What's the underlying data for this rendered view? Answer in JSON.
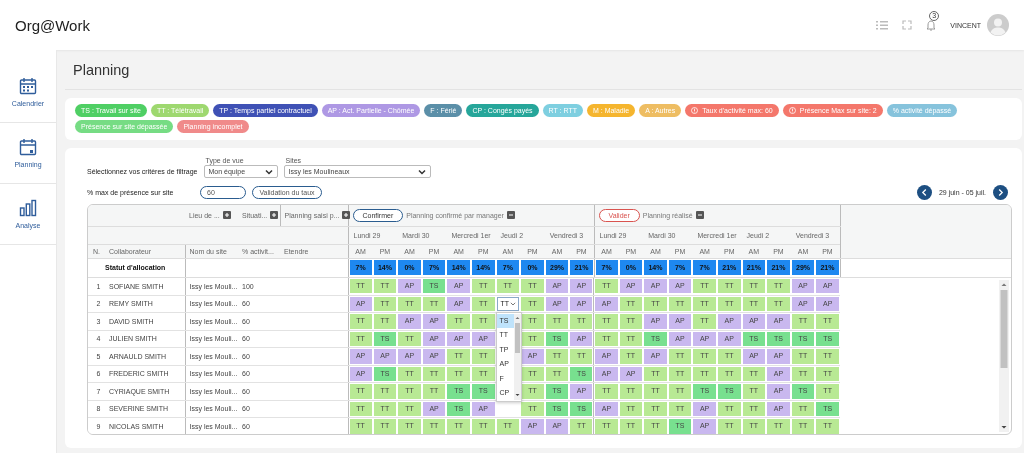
{
  "app": {
    "logo": "Org@Work",
    "notifications": "3",
    "user": "VINCENT"
  },
  "sidebar": {
    "items": [
      {
        "label": "Calendrier",
        "kind": "calendar"
      },
      {
        "label": "Planning",
        "kind": "planning"
      },
      {
        "label": "Analyse",
        "kind": "chart"
      }
    ]
  },
  "page": {
    "title": "Planning"
  },
  "legend": [
    {
      "label": "TS : Travail sur site",
      "color": "#4fcf64",
      "kind": "plain"
    },
    {
      "label": "TT : Télétravail",
      "color": "#9ed86f",
      "kind": "plain"
    },
    {
      "label": "TP : Temps partiel contractuel",
      "color": "#3f51b5",
      "kind": "plain"
    },
    {
      "label": "AP : Act. Partielle - Chômée",
      "color": "#ae98e4",
      "kind": "plain"
    },
    {
      "label": "F : Férié",
      "color": "#5b8fa8",
      "kind": "plain"
    },
    {
      "label": "CP : Congés payés",
      "color": "#26a69a",
      "kind": "plain"
    },
    {
      "label": "RT : RTT",
      "color": "#7ecfe0",
      "kind": "plain"
    },
    {
      "label": "M : Maladie",
      "color": "#f5b52e",
      "kind": "plain"
    },
    {
      "label": "A : Autres",
      "color": "#eebd62",
      "kind": "plain"
    },
    {
      "label": "Taux d'activité max: 60",
      "color": "#f4776b",
      "kind": "warning"
    },
    {
      "label": "Présence Max sur site: 2",
      "color": "#f4776b",
      "kind": "warning"
    },
    {
      "label": "% activité dépassé",
      "color": "#86c3dc",
      "kind": "plain"
    },
    {
      "label": "Présence sur site dépassée",
      "color": "#76dc84",
      "kind": "plain"
    },
    {
      "label": "Planning incomplet",
      "color": "#f08a8a",
      "kind": "plain"
    }
  ],
  "filters": {
    "title": "Sélectionnez vos critères de filtrage",
    "view_type": {
      "label": "Type de vue",
      "value": "Mon équipe"
    },
    "sites": {
      "label": "Sites",
      "value": "Issy les Moulineaux"
    },
    "max_presence": {
      "label": "% max de présence sur site",
      "value": "60",
      "button": "Validation du taux"
    },
    "period": "29 juin - 05 juil."
  },
  "table": {
    "group_headers": [
      {
        "label": "Lieu de ...",
        "expanded": false
      },
      {
        "label": "Situati...",
        "expanded": false
      },
      {
        "label": "Planning saisi p...",
        "expanded": false
      }
    ],
    "sections": [
      {
        "button": "Confirmer",
        "kind": "confirm",
        "title": "Planning confirmé par manager",
        "expanded": true,
        "days": [
          "Lundi 29",
          "Mardi 30",
          "Mercredi 1er",
          "Jeudi 2",
          "Vendredi 3"
        ],
        "slots": [
          "AM",
          "PM",
          "AM",
          "PM",
          "AM",
          "PM",
          "AM",
          "PM",
          "AM",
          "PM"
        ]
      },
      {
        "button": "Valider",
        "kind": "validate",
        "title": "Planning réalisé",
        "expanded": true,
        "days": [
          "Lundi 29",
          "Mardi 30",
          "Mercredi 1er",
          "Jeudi 2",
          "Vendredi 3"
        ],
        "slots": [
          "AM",
          "PM",
          "AM",
          "PM",
          "AM",
          "PM",
          "AM",
          "PM",
          "AM",
          "PM"
        ]
      }
    ],
    "columns": [
      "N.",
      "Collaborateur",
      "Nom du site",
      "% activit...",
      "Etendre"
    ],
    "allocation": {
      "label": "Statut d'allocation",
      "values": [
        "7%",
        "14%",
        "0%",
        "7%",
        "14%",
        "14%",
        "7%",
        "0%",
        "29%",
        "21%",
        "7%",
        "0%",
        "14%",
        "7%",
        "7%",
        "21%",
        "21%",
        "21%",
        "29%",
        "21%"
      ]
    },
    "rows": [
      {
        "n": "1",
        "name": "SOFIANE SMITH",
        "site": "Issy les Mouli...",
        "activity": "100",
        "cells": [
          {
            "code": "TT",
            "kind": "tt"
          },
          {
            "code": "TT",
            "kind": "tt"
          },
          {
            "code": "AP",
            "kind": "ap"
          },
          {
            "code": "TS",
            "kind": "ts"
          },
          {
            "code": "AP",
            "kind": "ap"
          },
          {
            "code": "TT",
            "kind": "tt"
          },
          {
            "code": "TT",
            "kind": "tt"
          },
          {
            "code": "TT",
            "kind": "tt"
          },
          {
            "code": "AP",
            "kind": "ap"
          },
          {
            "code": "AP",
            "kind": "ap"
          },
          {
            "code": "TT",
            "kind": "tt"
          },
          {
            "code": "AP",
            "kind": "ap"
          },
          {
            "code": "AP",
            "kind": "ap"
          },
          {
            "code": "AP",
            "kind": "ap"
          },
          {
            "code": "TT",
            "kind": "tt"
          },
          {
            "code": "TT",
            "kind": "tt"
          },
          {
            "code": "TT",
            "kind": "tt"
          },
          {
            "code": "TT",
            "kind": "tt"
          },
          {
            "code": "AP",
            "kind": "ap"
          },
          {
            "code": "AP",
            "kind": "ap"
          }
        ]
      },
      {
        "n": "2",
        "name": "REMY SMITH",
        "site": "Issy les Mouli...",
        "activity": "60",
        "cells": [
          {
            "code": "AP",
            "kind": "ap"
          },
          {
            "code": "TT",
            "kind": "tt"
          },
          {
            "code": "TT",
            "kind": "tt"
          },
          {
            "code": "TT",
            "kind": "tt"
          },
          {
            "code": "AP",
            "kind": "ap"
          },
          {
            "code": "TT",
            "kind": "tt"
          },
          {
            "code": "TT",
            "kind": "select",
            "expanded": true,
            "options": [
              {
                "label": "TS",
                "selected": true
              },
              {
                "label": "TT",
                "selected": false
              },
              {
                "label": "TP",
                "selected": false
              },
              {
                "label": "AP",
                "selected": false
              },
              {
                "label": "F",
                "selected": false
              },
              {
                "label": "CP",
                "selected": false
              }
            ]
          },
          {
            "code": "TT",
            "kind": "tt"
          },
          {
            "code": "AP",
            "kind": "ap"
          },
          {
            "code": "AP",
            "kind": "ap"
          },
          {
            "code": "AP",
            "kind": "ap"
          },
          {
            "code": "TT",
            "kind": "tt"
          },
          {
            "code": "TT",
            "kind": "tt"
          },
          {
            "code": "TT",
            "kind": "tt"
          },
          {
            "code": "TT",
            "kind": "tt"
          },
          {
            "code": "TT",
            "kind": "tt"
          },
          {
            "code": "TT",
            "kind": "tt"
          },
          {
            "code": "TT",
            "kind": "tt"
          },
          {
            "code": "AP",
            "kind": "ap"
          },
          {
            "code": "AP",
            "kind": "ap"
          }
        ]
      },
      {
        "n": "3",
        "name": "DAVID SMITH",
        "site": "Issy les Mouli...",
        "activity": "60",
        "cells": [
          {
            "code": "TT",
            "kind": "tt"
          },
          {
            "code": "TT",
            "kind": "tt"
          },
          {
            "code": "AP",
            "kind": "ap"
          },
          {
            "code": "AP",
            "kind": "ap"
          },
          {
            "code": "TT",
            "kind": "tt"
          },
          {
            "code": "TT",
            "kind": "tt"
          },
          null,
          {
            "code": "TT",
            "kind": "tt"
          },
          {
            "code": "TT",
            "kind": "tt"
          },
          {
            "code": "TT",
            "kind": "tt"
          },
          {
            "code": "TT",
            "kind": "tt"
          },
          {
            "code": "TT",
            "kind": "tt"
          },
          {
            "code": "AP",
            "kind": "ap"
          },
          {
            "code": "AP",
            "kind": "ap"
          },
          {
            "code": "TT",
            "kind": "tt"
          },
          {
            "code": "AP",
            "kind": "ap"
          },
          {
            "code": "AP",
            "kind": "ap"
          },
          {
            "code": "AP",
            "kind": "ap"
          },
          {
            "code": "TT",
            "kind": "tt"
          },
          {
            "code": "TT",
            "kind": "tt"
          }
        ]
      },
      {
        "n": "4",
        "name": "JULIEN SMITH",
        "site": "Issy les Mouli...",
        "activity": "60",
        "cells": [
          {
            "code": "TT",
            "kind": "tt"
          },
          {
            "code": "TS",
            "kind": "ts"
          },
          {
            "code": "TT",
            "kind": "tt"
          },
          {
            "code": "AP",
            "kind": "ap"
          },
          {
            "code": "AP",
            "kind": "ap"
          },
          {
            "code": "AP",
            "kind": "ap"
          },
          null,
          {
            "code": "TT",
            "kind": "tt"
          },
          {
            "code": "TS",
            "kind": "ts"
          },
          {
            "code": "AP",
            "kind": "ap"
          },
          {
            "code": "TT",
            "kind": "tt"
          },
          {
            "code": "TT",
            "kind": "tt"
          },
          {
            "code": "TS",
            "kind": "ts"
          },
          {
            "code": "AP",
            "kind": "ap"
          },
          {
            "code": "AP",
            "kind": "ap"
          },
          {
            "code": "AP",
            "kind": "ap"
          },
          {
            "code": "TS",
            "kind": "ts"
          },
          {
            "code": "TS",
            "kind": "ts"
          },
          {
            "code": "TS",
            "kind": "ts"
          },
          {
            "code": "TS",
            "kind": "ts"
          }
        ]
      },
      {
        "n": "5",
        "name": "ARNAULD SMITH",
        "site": "Issy les Mouli...",
        "activity": "60",
        "cells": [
          {
            "code": "AP",
            "kind": "ap"
          },
          {
            "code": "AP",
            "kind": "ap"
          },
          {
            "code": "AP",
            "kind": "ap"
          },
          {
            "code": "AP",
            "kind": "ap"
          },
          {
            "code": "TT",
            "kind": "tt"
          },
          {
            "code": "TT",
            "kind": "tt"
          },
          null,
          {
            "code": "AP",
            "kind": "ap"
          },
          {
            "code": "TT",
            "kind": "tt"
          },
          {
            "code": "TT",
            "kind": "tt"
          },
          {
            "code": "AP",
            "kind": "ap"
          },
          {
            "code": "TT",
            "kind": "tt"
          },
          {
            "code": "AP",
            "kind": "ap"
          },
          {
            "code": "TT",
            "kind": "tt"
          },
          {
            "code": "TT",
            "kind": "tt"
          },
          {
            "code": "TT",
            "kind": "tt"
          },
          {
            "code": "AP",
            "kind": "ap"
          },
          {
            "code": "AP",
            "kind": "ap"
          },
          {
            "code": "TT",
            "kind": "tt"
          },
          {
            "code": "TT",
            "kind": "tt"
          }
        ]
      },
      {
        "n": "6",
        "name": "FREDERIC SMITH",
        "site": "Issy les Mouli...",
        "activity": "60",
        "cells": [
          {
            "code": "AP",
            "kind": "ap"
          },
          {
            "code": "TS",
            "kind": "ts"
          },
          {
            "code": "TT",
            "kind": "tt"
          },
          {
            "code": "TT",
            "kind": "tt"
          },
          {
            "code": "TT",
            "kind": "tt"
          },
          {
            "code": "TT",
            "kind": "tt"
          },
          null,
          {
            "code": "TT",
            "kind": "tt"
          },
          {
            "code": "TT",
            "kind": "tt"
          },
          {
            "code": "TS",
            "kind": "ts"
          },
          {
            "code": "AP",
            "kind": "ap"
          },
          {
            "code": "AP",
            "kind": "ap"
          },
          {
            "code": "TT",
            "kind": "tt"
          },
          {
            "code": "TT",
            "kind": "tt"
          },
          {
            "code": "TT",
            "kind": "tt"
          },
          {
            "code": "TT",
            "kind": "tt"
          },
          {
            "code": "TT",
            "kind": "tt"
          },
          {
            "code": "AP",
            "kind": "ap"
          },
          {
            "code": "TT",
            "kind": "tt"
          },
          {
            "code": "TT",
            "kind": "tt"
          }
        ]
      },
      {
        "n": "7",
        "name": "CYRIAQUE SMITH",
        "site": "Issy les Mouli...",
        "activity": "60",
        "cells": [
          {
            "code": "TT",
            "kind": "tt"
          },
          {
            "code": "TT",
            "kind": "tt"
          },
          {
            "code": "TT",
            "kind": "tt"
          },
          {
            "code": "TT",
            "kind": "tt"
          },
          {
            "code": "TS",
            "kind": "ts"
          },
          {
            "code": "TS",
            "kind": "ts"
          },
          null,
          {
            "code": "TT",
            "kind": "tt"
          },
          {
            "code": "TS",
            "kind": "ts"
          },
          {
            "code": "AP",
            "kind": "ap"
          },
          {
            "code": "TT",
            "kind": "tt"
          },
          {
            "code": "TT",
            "kind": "tt"
          },
          {
            "code": "TT",
            "kind": "tt"
          },
          {
            "code": "TT",
            "kind": "tt"
          },
          {
            "code": "TS",
            "kind": "ts"
          },
          {
            "code": "TS",
            "kind": "ts"
          },
          {
            "code": "TT",
            "kind": "tt"
          },
          {
            "code": "AP",
            "kind": "ap"
          },
          {
            "code": "TS",
            "kind": "ts"
          },
          {
            "code": "TT",
            "kind": "tt"
          }
        ]
      },
      {
        "n": "8",
        "name": "SEVERINE SMITH",
        "site": "Issy les Mouli...",
        "activity": "60",
        "cells": [
          {
            "code": "TT",
            "kind": "tt"
          },
          {
            "code": "TT",
            "kind": "tt"
          },
          {
            "code": "TT",
            "kind": "tt"
          },
          {
            "code": "AP",
            "kind": "ap"
          },
          {
            "code": "TS",
            "kind": "ts"
          },
          {
            "code": "AP",
            "kind": "ap"
          },
          null,
          {
            "code": "TT",
            "kind": "tt"
          },
          {
            "code": "TS",
            "kind": "ts"
          },
          {
            "code": "TS",
            "kind": "ts"
          },
          {
            "code": "AP",
            "kind": "ap"
          },
          {
            "code": "TT",
            "kind": "tt"
          },
          {
            "code": "TT",
            "kind": "tt"
          },
          {
            "code": "TT",
            "kind": "tt"
          },
          {
            "code": "AP",
            "kind": "ap"
          },
          {
            "code": "TT",
            "kind": "tt"
          },
          {
            "code": "TT",
            "kind": "tt"
          },
          {
            "code": "AP",
            "kind": "ap"
          },
          {
            "code": "TT",
            "kind": "tt"
          },
          {
            "code": "TS",
            "kind": "ts"
          }
        ]
      },
      {
        "n": "9",
        "name": "NICOLAS SMITH",
        "site": "Issy les Mouli...",
        "activity": "60",
        "cells": [
          {
            "code": "TT",
            "kind": "tt"
          },
          {
            "code": "TT",
            "kind": "tt"
          },
          {
            "code": "TT",
            "kind": "tt"
          },
          {
            "code": "TT",
            "kind": "tt"
          },
          {
            "code": "TT",
            "kind": "tt"
          },
          {
            "code": "TT",
            "kind": "tt"
          },
          {
            "code": "TT",
            "kind": "tt"
          },
          {
            "code": "AP",
            "kind": "ap"
          },
          {
            "code": "AP",
            "kind": "ap"
          },
          {
            "code": "TT",
            "kind": "tt"
          },
          {
            "code": "TT",
            "kind": "tt"
          },
          {
            "code": "TT",
            "kind": "tt"
          },
          {
            "code": "TT",
            "kind": "tt"
          },
          {
            "code": "TS",
            "kind": "ts"
          },
          {
            "code": "AP",
            "kind": "ap"
          },
          {
            "code": "TT",
            "kind": "tt"
          },
          {
            "code": "TT",
            "kind": "tt"
          },
          {
            "code": "TT",
            "kind": "tt"
          },
          {
            "code": "TT",
            "kind": "tt"
          },
          {
            "code": "TT",
            "kind": "tt"
          }
        ]
      }
    ]
  }
}
